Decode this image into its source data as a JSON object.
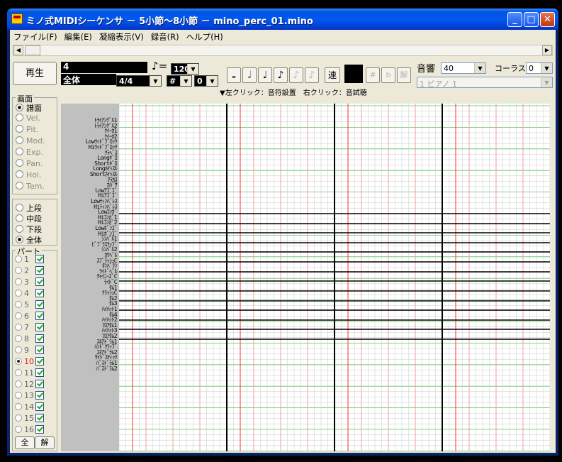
{
  "window": {
    "title": "ミノ式MIDIシーケンサ － 5小節～8小節 － mino_perc_01.mino",
    "minimize": "_",
    "maximize": "□",
    "close": "✕"
  },
  "menu": [
    "ファイル(F)",
    "編集(E)",
    "凝縮表示(V)",
    "録音(R)",
    "ヘルプ(H)"
  ],
  "toolbar": {
    "play_label": "再生",
    "measure": "4",
    "scope": "全体",
    "time_signature": "4/4",
    "tempo_symbol": "♪=",
    "tempo": "120",
    "key_sign": "#",
    "key_value": "0",
    "notes": [
      "𝅝",
      "𝅗𝅥",
      "♩",
      "♪",
      "𝅘𝅥𝅯",
      "𝅘𝅥𝅰"
    ],
    "ren_label": "連",
    "sharp": "#",
    "flat": "b",
    "natural": "解",
    "hint": "▼左クリック：音符設置　右クリック：音試聴",
    "reverb_label": "音響",
    "reverb_value": "40",
    "chorus_label": "コーラス",
    "chorus_value": "0",
    "instrument": "1 ピアノ 1"
  },
  "view_group": {
    "title": "画面",
    "items": [
      {
        "label": "譜面",
        "selected": true,
        "enabled": true
      },
      {
        "label": "Vel.",
        "selected": false,
        "enabled": false
      },
      {
        "label": "Pit.",
        "selected": false,
        "enabled": false
      },
      {
        "label": "Mod.",
        "selected": false,
        "enabled": false
      },
      {
        "label": "Exp.",
        "selected": false,
        "enabled": false
      },
      {
        "label": "Pan.",
        "selected": false,
        "enabled": false
      },
      {
        "label": "Hol.",
        "selected": false,
        "enabled": false
      },
      {
        "label": "Tem.",
        "selected": false,
        "enabled": false
      }
    ]
  },
  "range_group": {
    "items": [
      {
        "label": "上段",
        "selected": false
      },
      {
        "label": "中段",
        "selected": false
      },
      {
        "label": "下段",
        "selected": false
      },
      {
        "label": "全体",
        "selected": true
      }
    ]
  },
  "part_group": {
    "title": "パート",
    "parts": [
      {
        "num": "1",
        "selected": false,
        "checked": true
      },
      {
        "num": "2",
        "selected": false,
        "checked": true
      },
      {
        "num": "3",
        "selected": false,
        "checked": true
      },
      {
        "num": "4",
        "selected": false,
        "checked": true
      },
      {
        "num": "5",
        "selected": false,
        "checked": true
      },
      {
        "num": "6",
        "selected": false,
        "checked": true
      },
      {
        "num": "7",
        "selected": false,
        "checked": true
      },
      {
        "num": "8",
        "selected": false,
        "checked": true
      },
      {
        "num": "9",
        "selected": false,
        "checked": true
      },
      {
        "num": "10",
        "selected": true,
        "checked": true
      },
      {
        "num": "11",
        "selected": false,
        "checked": true
      },
      {
        "num": "12",
        "selected": false,
        "checked": true
      },
      {
        "num": "13",
        "selected": false,
        "checked": true
      },
      {
        "num": "14",
        "selected": false,
        "checked": true
      },
      {
        "num": "15",
        "selected": false,
        "checked": true
      },
      {
        "num": "16",
        "selected": false,
        "checked": true
      }
    ],
    "all_label": "全",
    "release_label": "解"
  },
  "instruments": [
    "ﾄﾗｲｱﾝｸﾞﾙ1",
    "ﾄﾗｲｱﾝｸﾞﾙ2",
    "ｸｲｰｶ1",
    "ｸｲｰｶ2",
    "Lowｳｯﾄﾞﾌﾞﾛｯｸ",
    "Hiｳｯﾄﾞﾌﾞﾛｯｸ",
    "ｸﾗﾍﾞｽ",
    "Longｷﾞﾛ",
    "Shortｷﾞﾛ",
    "Longﾎｲｯｽﾙ",
    "Shortﾎｲｯｽﾙ",
    "ﾏﾗｶｽ",
    "ｶﾊﾞｻ",
    "Lowｱｺﾞｺﾞ",
    "Hiｱｺﾞｺﾞ",
    "Lowﾃｨﾝﾊﾞﾚｽ",
    "Hiﾃｨﾝﾊﾞﾚｽ",
    "Lowｺﾝｶﾞ",
    "Hiｺﾝｶﾞ1",
    "Hiｺﾝｶﾞ2",
    "Lowﾎﾞﾝｺﾞ",
    "Hiﾎﾞﾝｺﾞ",
    "ｼﾝﾊﾞﾙ1",
    "ﾋﾞﾌﾞﾗｽﾗｯﾌﾟ",
    "ｼﾝﾊﾞﾙ2",
    "ｶｳﾍﾞﾙ",
    "ｽﾌﾟﾗｯｼｭC",
    "ﾀﾝﾊﾞﾘﾝ",
    "ﾗｲﾄﾞﾍﾞﾙ",
    "ﾁｬｲﾆｰｽﾞC",
    "ﾗｲﾄﾞC",
    "ﾀﾑ1",
    "ｸﾗｯｼｭC",
    "ﾀﾑ2",
    "ﾀﾑ3",
    "ﾊｲﾊｯﾄ1",
    "ﾀﾑ4",
    "ﾊｲﾊｯﾄ2",
    "ﾌﾛｱﾀﾑ1",
    "ﾊｲﾊｯﾄ3",
    "ﾌﾛｱﾀﾑ2",
    "ｽﾈｱﾄﾞﾗﾑ1",
    "ﾊﾝﾄﾞｸﾗｯﾌﾟ",
    "ｽﾈｱﾄﾞﾗﾑ2",
    "ｻｲﾄﾞｽﾃｨｯｸ",
    "ﾊﾞｽﾄﾞﾗﾑ1",
    "ﾊﾞｽﾄﾞﾗﾑ2"
  ],
  "colors": {
    "grid_red": "#ff3030",
    "grid_pink": "#f0a0a0",
    "grid_green": "#5cc05c",
    "grid_thin": "#c8c8c8",
    "part_selected": "#e02010"
  }
}
